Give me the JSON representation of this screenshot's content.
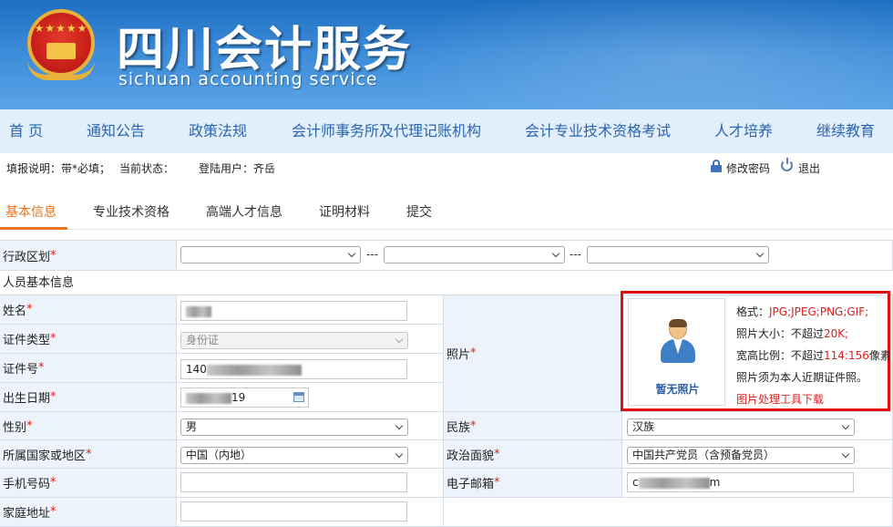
{
  "header": {
    "title": "四川会计服务",
    "subtitle": "sichuan accounting service"
  },
  "nav": {
    "items": [
      "首 页",
      "通知公告",
      "政策法规",
      "会计师事务所及代理记账机构",
      "会计专业技术资格考试",
      "人才培养",
      "继续教育"
    ]
  },
  "status": {
    "fill_note": "填报说明：带*必填；",
    "current_state": "当前状态：",
    "login_user_label": "登陆用户：",
    "login_user_value": "齐岳",
    "change_password": "修改密码",
    "logout": "退出"
  },
  "tabs": [
    "基本信息",
    "专业技术资格",
    "高端人才信息",
    "证明材料",
    "提交"
  ],
  "form": {
    "region_label": "行政区划",
    "region_sep": "---",
    "section_title": "人员基本信息",
    "name_label": "姓名",
    "id_type_label": "证件类型",
    "id_type_value": "身份证",
    "id_no_label": "证件号",
    "id_no_prefix": "140",
    "birth_label": "出生日期",
    "birth_suffix": "19",
    "gender_label": "性别",
    "gender_value": "男",
    "country_label": "所属国家或地区",
    "country_value": "中国（内地）",
    "phone_label": "手机号码",
    "address_label": "家庭地址",
    "photo_label": "照片",
    "ethnicity_label": "民族",
    "ethnicity_value": "汉族",
    "political_label": "政治面貌",
    "political_value": "中国共产党员（含预备党员）",
    "email_label": "电子邮箱",
    "email_prefix": "c",
    "email_suffix": "m",
    "required_mark": "*"
  },
  "photo": {
    "placeholder": "暂无照片",
    "format_label": "格式：",
    "format_value": "JPG;JPEG;PNG;GIF;",
    "size_label": "照片大小：不超过",
    "size_value": "20K;",
    "ratio_label": "宽高比例：不超过",
    "ratio_value": "114:156",
    "ratio_suffix": "像素",
    "note": "照片须为本人近期证件照。",
    "tool_link": "图片处理工具下载"
  }
}
